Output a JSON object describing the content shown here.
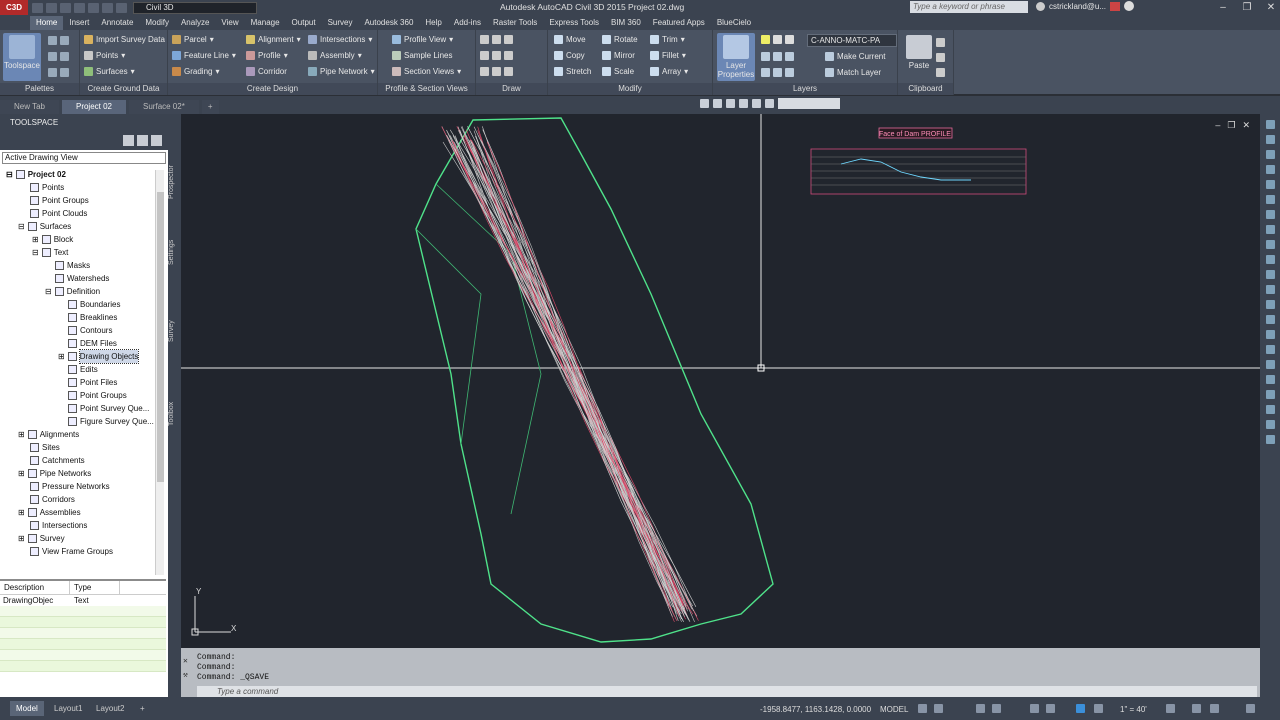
{
  "titlebar": {
    "logo": "C3D",
    "workspace": "Civil 3D",
    "title": "Autodesk AutoCAD Civil 3D 2015   Project 02.dwg",
    "search_placeholder": "Type a keyword or phrase",
    "user": "cstrickland@u..."
  },
  "ribbon_tabs": [
    "Home",
    "Insert",
    "Annotate",
    "Modify",
    "Analyze",
    "View",
    "Manage",
    "Output",
    "Survey",
    "Autodesk 360",
    "Help",
    "Add-ins",
    "Raster Tools",
    "Express Tools",
    "BIM 360",
    "Featured Apps",
    "BlueCielo"
  ],
  "ribbon": {
    "toolspace": "Toolspace",
    "import_survey": "Import Survey Data",
    "points": "Points",
    "surfaces": "Surfaces",
    "parcel": "Parcel",
    "feature_line": "Feature Line",
    "grading": "Grading",
    "alignment": "Alignment",
    "profile": "Profile",
    "corridor": "Corridor",
    "intersections": "Intersections",
    "assembly": "Assembly",
    "pipe_network": "Pipe Network",
    "profile_view": "Profile View",
    "sample_lines": "Sample Lines",
    "section_views": "Section Views",
    "move": "Move",
    "copy": "Copy",
    "stretch": "Stretch",
    "rotate": "Rotate",
    "mirror": "Mirror",
    "scale": "Scale",
    "trim": "Trim",
    "fillet": "Fillet",
    "array": "Array",
    "layer_properties": "Layer Properties",
    "layer_combo": "C-ANNO-MATC-PA",
    "make_current": "Make Current",
    "match_layer": "Match Layer",
    "paste": "Paste",
    "panel_titles": {
      "palettes": "Palettes",
      "create_ground": "Create Ground Data",
      "create_design": "Create Design",
      "profile_section": "Profile & Section Views",
      "draw": "Draw",
      "modify": "Modify",
      "layers": "Layers",
      "clipboard": "Clipboard"
    }
  },
  "doc_tabs": [
    "New Tab",
    "Project 02",
    "Surface 02*"
  ],
  "toolspace": {
    "header": "TOOLSPACE",
    "view": "Active Drawing View",
    "tree": [
      {
        "label": "Project 02",
        "indent": 0
      },
      {
        "label": "Points",
        "indent": 1
      },
      {
        "label": "Point Groups",
        "indent": 1
      },
      {
        "label": "Point Clouds",
        "indent": 1
      },
      {
        "label": "Surfaces",
        "indent": 1
      },
      {
        "label": "Block",
        "indent": 2
      },
      {
        "label": "Text",
        "indent": 2
      },
      {
        "label": "Masks",
        "indent": 3
      },
      {
        "label": "Watersheds",
        "indent": 3
      },
      {
        "label": "Definition",
        "indent": 3
      },
      {
        "label": "Boundaries",
        "indent": 4
      },
      {
        "label": "Breaklines",
        "indent": 4
      },
      {
        "label": "Contours",
        "indent": 4
      },
      {
        "label": "DEM Files",
        "indent": 4
      },
      {
        "label": "Drawing Objects",
        "indent": 4
      },
      {
        "label": "Edits",
        "indent": 4
      },
      {
        "label": "Point Files",
        "indent": 4
      },
      {
        "label": "Point Groups",
        "indent": 4
      },
      {
        "label": "Point Survey Que...",
        "indent": 4
      },
      {
        "label": "Figure Survey Que...",
        "indent": 4
      },
      {
        "label": "Alignments",
        "indent": 1
      },
      {
        "label": "Sites",
        "indent": 1
      },
      {
        "label": "Catchments",
        "indent": 1
      },
      {
        "label": "Pipe Networks",
        "indent": 1
      },
      {
        "label": "Pressure Networks",
        "indent": 1
      },
      {
        "label": "Corridors",
        "indent": 1
      },
      {
        "label": "Assemblies",
        "indent": 1
      },
      {
        "label": "Intersections",
        "indent": 1
      },
      {
        "label": "Survey",
        "indent": 1
      },
      {
        "label": "View Frame Groups",
        "indent": 1
      }
    ],
    "side_tabs": [
      "Prospector",
      "Settings",
      "Survey",
      "Toolbox"
    ],
    "props_headers": [
      "Description",
      "Type"
    ],
    "props_row": [
      "DrawingObjec",
      "Text"
    ]
  },
  "profile_title": "Face of Dam PROFILE",
  "command": {
    "lines": [
      "Command:",
      "Command:",
      "Command:  _QSAVE"
    ],
    "placeholder": "Type a command"
  },
  "status": {
    "layout_tabs": [
      "Model",
      "Layout1",
      "Layout2"
    ],
    "coords": "-1958.8477, 1163.1428, 0.0000",
    "model": "MODEL",
    "scale": "1\" = 40'"
  }
}
